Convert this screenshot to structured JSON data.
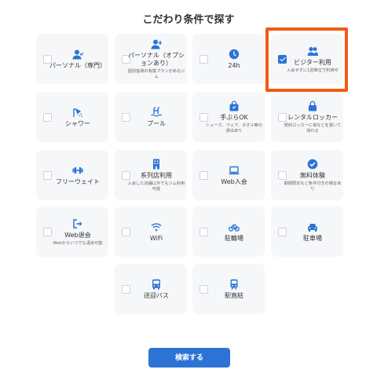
{
  "page": {
    "title": "こだわり条件で探す"
  },
  "options": [
    {
      "id": "personal-dedicated",
      "label": "パーソナル（専門）",
      "sub": "",
      "icon": "person-check-icon",
      "checked": false
    },
    {
      "id": "personal-optional",
      "label": "パーソナル（オプションあり）",
      "sub": "個別指導の有償プランがあるジム",
      "icon": "person-plus-icon",
      "checked": false
    },
    {
      "id": "24h",
      "label": "24h",
      "sub": "",
      "icon": "clock-icon",
      "checked": false
    },
    {
      "id": "visitor",
      "label": "ビジター利用",
      "sub": "入会せずに1回単位で利用可",
      "icon": "people-icon",
      "checked": true
    },
    {
      "id": "shower",
      "label": "シャワー",
      "sub": "",
      "icon": "shower-icon",
      "checked": false
    },
    {
      "id": "pool",
      "label": "プール",
      "sub": "",
      "icon": "pool-icon",
      "checked": false
    },
    {
      "id": "empty-handed",
      "label": "手ぶらOK",
      "sub": "シューズ、ウェア、タオル等の貸出あり",
      "icon": "bag-icon",
      "checked": false
    },
    {
      "id": "rental-locker",
      "label": "レンタルロッカー",
      "sub": "契約ロッカーに荷などを置いて帰れる",
      "icon": "lock-icon",
      "checked": false
    },
    {
      "id": "free-weight",
      "label": "フリーウェイト",
      "sub": "",
      "icon": "dumbbell-icon",
      "checked": false
    },
    {
      "id": "affiliate-store",
      "label": "系列店利用",
      "sub": "入会した店舗以外でもジム利用可能",
      "icon": "building-icon",
      "checked": false
    },
    {
      "id": "web-join",
      "label": "Web入会",
      "sub": "",
      "icon": "laptop-icon",
      "checked": false
    },
    {
      "id": "free-trial",
      "label": "無料体験",
      "sub": "期間限定など条件付きの場合あり",
      "icon": "check-badge-icon",
      "checked": false
    },
    {
      "id": "web-cancel",
      "label": "Web退会",
      "sub": "Webからいつでも退会可能",
      "icon": "exit-icon",
      "checked": false
    },
    {
      "id": "wifi",
      "label": "WiFi",
      "sub": "",
      "icon": "wifi-icon",
      "checked": false
    },
    {
      "id": "bicycle-parking",
      "label": "駐輪場",
      "sub": "",
      "icon": "bicycle-icon",
      "checked": false
    },
    {
      "id": "parking",
      "label": "駐車場",
      "sub": "",
      "icon": "car-icon",
      "checked": false
    },
    {
      "id": "shuttle-bus",
      "label": "送迎バス",
      "sub": "",
      "icon": "bus-icon",
      "checked": false
    },
    {
      "id": "station-direct",
      "label": "駅直結",
      "sub": "",
      "icon": "train-icon",
      "checked": false
    }
  ],
  "search_button": {
    "label": "検索する"
  },
  "colors": {
    "accent": "#2b74d6",
    "highlight": "#f25a16",
    "card_bg": "#f6f7f9"
  }
}
